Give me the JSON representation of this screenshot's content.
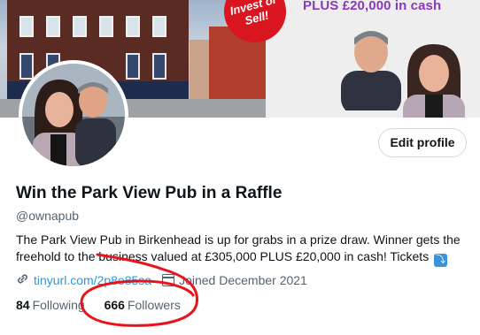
{
  "banner": {
    "promo_text": "PLUS £20,000 in cash",
    "badge_text": "Invest or Sell!",
    "badge_partial": "t"
  },
  "profile": {
    "name": "Win the Park View Pub in a Raffle",
    "handle": "@ownapub",
    "edit_button_label": "Edit profile",
    "bio_line1": "The Park View Pub in Birkenhead is up for grabs in a prize draw. Winner gets the",
    "bio_line2": "freehold to the business valued at £305,000 PLUS £20,000 in cash! Tickets",
    "bio_emoji": "⤵",
    "link_text": "tinyurl.com/2p8e85sa",
    "joined_text": "Joined December 2021",
    "following_count": "84",
    "following_label": "Following",
    "followers_count": "666",
    "followers_label": "Followers"
  },
  "icons": {
    "link": "link-icon",
    "calendar": "calendar-icon"
  },
  "colors": {
    "accent": "#1d9bf0",
    "secondary_text": "#536471",
    "annotation": "#e8141c",
    "promo": "#8a3ab9"
  }
}
